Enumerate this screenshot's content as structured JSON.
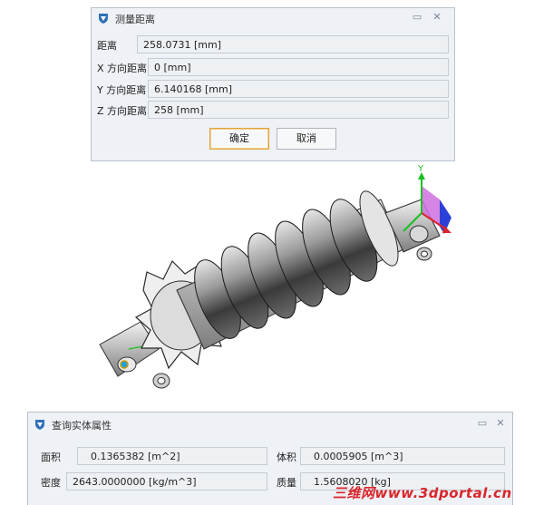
{
  "measure_dialog": {
    "title": "测量距离",
    "rows": [
      {
        "label": "距离",
        "value": "258.0731  [mm]"
      },
      {
        "label": "X 方向距离",
        "value": "0  [mm]"
      },
      {
        "label": "Y 方向距离",
        "value": "6.140168  [mm]"
      },
      {
        "label": "Z 方向距离",
        "value": "258  [mm]"
      }
    ],
    "ok_label": "确定",
    "cancel_label": "取消"
  },
  "viewport": {
    "triad_y_label": "Y"
  },
  "props_dialog": {
    "title": "查询实体属性",
    "area_label": "面积",
    "area_value": "0.1365382 [m^2]",
    "volume_label": "体积",
    "volume_value": "0.0005905 [m^3]",
    "density_label": "密度",
    "density_value": "2643.0000000 [kg/m^3]",
    "mass_label": "质量",
    "mass_value": "1.5608020 [kg]"
  },
  "watermark": "三维网www.3dportal.cn",
  "colors": {
    "ok_border": "#e0a340",
    "dialog_bg": "#eef1f5",
    "watermark": "#d8262b"
  }
}
